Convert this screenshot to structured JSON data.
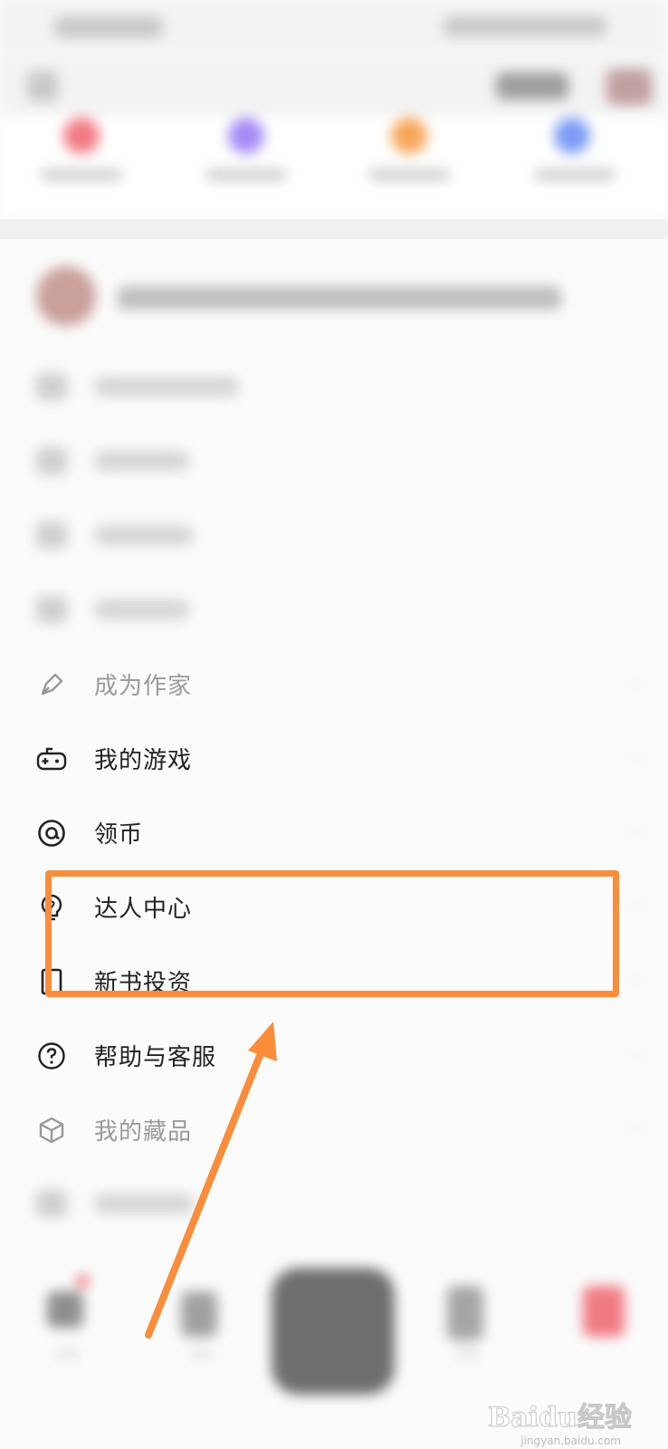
{
  "menu": {
    "items": [
      {
        "label": "成为作家",
        "icon": "pen-icon",
        "faded": true
      },
      {
        "label": "我的游戏",
        "icon": "gamepad-icon"
      },
      {
        "label": "领币",
        "icon": "coin-icon"
      },
      {
        "label": "达人中心",
        "icon": "bulb-icon"
      },
      {
        "label": "新书投资",
        "icon": "book-icon"
      },
      {
        "label": "帮助与客服",
        "icon": "help-icon"
      },
      {
        "label": "我的藏品",
        "icon": "cube-icon",
        "faded": true
      }
    ],
    "chevron": "›"
  },
  "annotation": {
    "color": "#fb8c3a",
    "target": "达人中心"
  },
  "watermark": {
    "text": "Baidu经验",
    "sub": "jingyan.baidu.com"
  }
}
